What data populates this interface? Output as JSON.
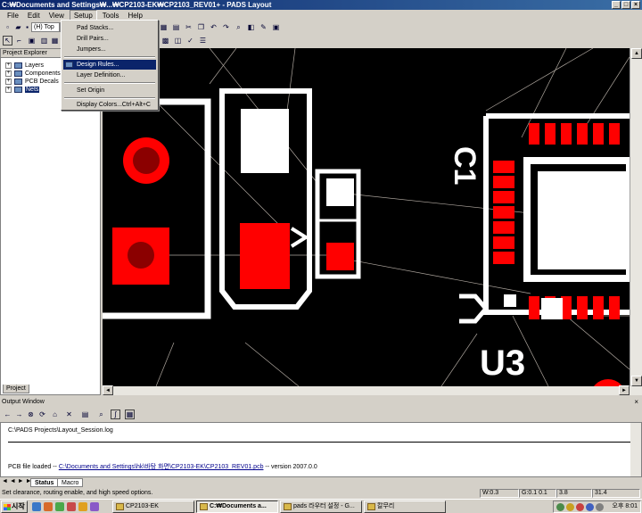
{
  "window": {
    "title": "C:₩Documents and Settings₩...₩CP2103-EK₩CP2103_REV01+ - PADS Layout"
  },
  "menu": {
    "items": [
      "File",
      "Edit",
      "View",
      "Setup",
      "Tools",
      "Help"
    ]
  },
  "toolbar": {
    "layer_value": "(H) Top"
  },
  "setup_menu": {
    "items": [
      {
        "label": "Pad Stacks..."
      },
      {
        "label": "Drill Pairs..."
      },
      {
        "label": "Jumpers..."
      },
      {
        "label": "Design Rules..."
      },
      {
        "label": "Layer Definition..."
      },
      {
        "label": "Set Origin"
      },
      {
        "label": "Display Colors...",
        "shortcut": "Ctrl+Alt+C"
      }
    ]
  },
  "project_explorer": {
    "title": "Project Explorer",
    "items": [
      "Layers",
      "Components",
      "PCB Decals",
      "Nets"
    ],
    "tab": "Project"
  },
  "canvas": {
    "labels": {
      "c1": "C1",
      "u3": "U3"
    },
    "colors": {
      "background": "#000000",
      "pad": "#ff0000",
      "silkscreen": "#ffffff",
      "drill": "#8b0000",
      "ratsnest": "#b0a8a0"
    }
  },
  "output": {
    "title": "Output Window",
    "line1": "C:\\PADS Projects\\Layout_Session.log",
    "line2_prefix": "PCB file loaded -- ",
    "line2_link": "C:\\Documents and Settings\\hk\\바탕 화면\\CP2103-EK\\CP2103_REV01.pcb",
    "line2_suffix": " -- version 2007.0.0",
    "tabs": [
      "Status",
      "Macro"
    ]
  },
  "status": {
    "message": "Set clearance, routing enable, and high speed options.",
    "width": "W:0.3",
    "grid": "G:0.1 0.1",
    "x": "3.8",
    "y": "31.4"
  },
  "taskbar": {
    "start": "시작",
    "tasks": [
      "CP2103-EK",
      "C:₩Documents a...",
      "pads 라우터 설정 - G...",
      "칼무리"
    ],
    "clock": "오후 8:01"
  }
}
